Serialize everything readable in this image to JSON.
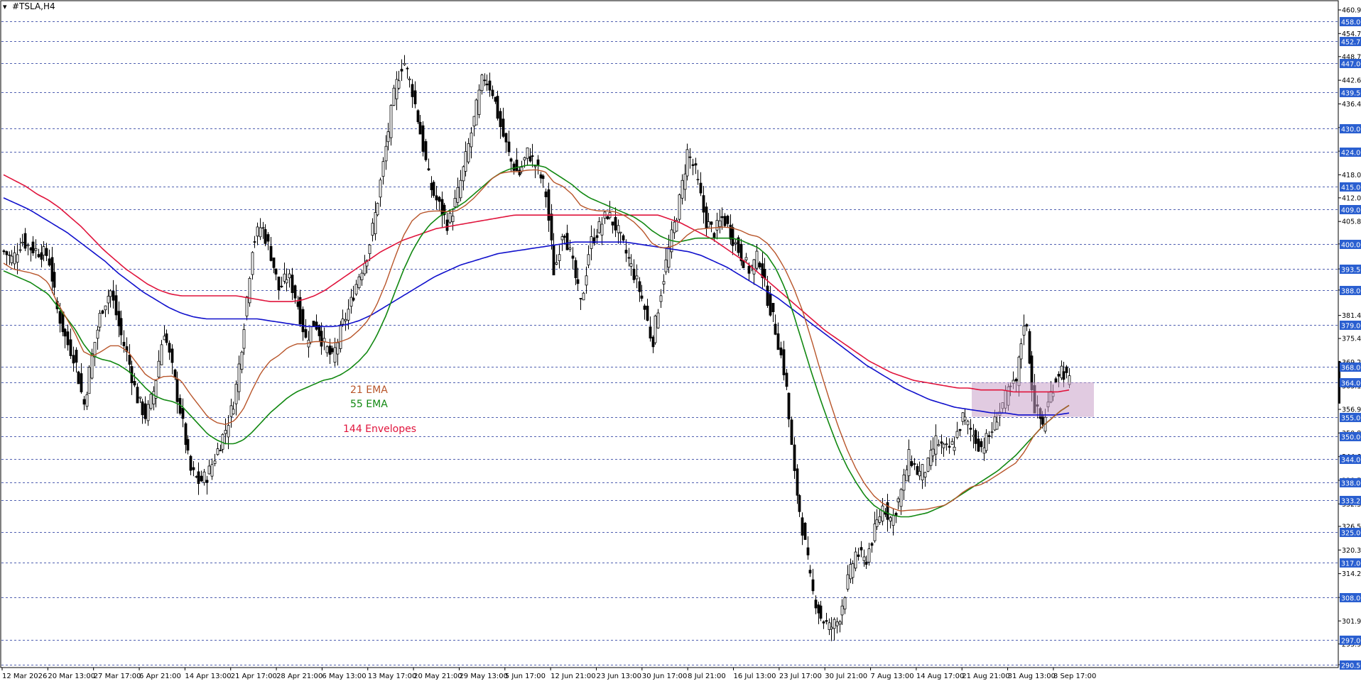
{
  "window": {
    "title": "#TSLA,H4"
  },
  "indicators": {
    "ema21_label": "21 EMA",
    "ema55_label": "55 EMA",
    "env144_label": "144 Envelopes"
  },
  "colors": {
    "background": "#ffffff",
    "candle": "#000000",
    "ema21": "#b8552a",
    "ema55": "#118811",
    "envelope_upper": "#e0143c",
    "envelope_lower": "#1010cc",
    "grid": "#5060b0",
    "price_tag_bg": "#2a5fd0",
    "zone_fill": "#c8a0c8",
    "current_price_bar": "#000000"
  },
  "chart_data": {
    "type": "candlestick",
    "symbol": "#TSLA",
    "timeframe": "H4",
    "ylim": [
      290.5,
      460.9
    ],
    "price_axis_ticks": [
      "460.90",
      "454.75",
      "448.75",
      "442.60",
      "436.45",
      "430.30",
      "424.15",
      "418.00",
      "412.00",
      "405.85",
      "400.00",
      "393.50",
      "388.00",
      "381.40",
      "375.40",
      "369.25",
      "363.10",
      "356.95",
      "350.80",
      "344.65",
      "338.50",
      "332.35",
      "326.50",
      "320.35",
      "314.20",
      "308.00",
      "301.90",
      "295.90",
      "290.50"
    ],
    "highlighted_levels": [
      "458.00",
      "452.75",
      "447.00",
      "439.50",
      "430.00",
      "424.00",
      "415.00",
      "409.00",
      "400.00",
      "393.50",
      "388.00",
      "379.00",
      "368.00",
      "364.00",
      "355.00",
      "350.00",
      "344.00",
      "338.00",
      "333.25",
      "325.00",
      "317.00",
      "308.00",
      "297.00",
      "290.50"
    ],
    "time_axis_labels": [
      "12 Mar 2026",
      "20 Mar 13:00",
      "27 Mar 17:00",
      "6 Apr 21:00",
      "14 Apr 13:00",
      "21 Apr 17:00",
      "28 Apr 21:00",
      "6 May 13:00",
      "13 May 17:00",
      "20 May 21:00",
      "29 May 13:00",
      "5 Jun 17:00",
      "12 Jun 21:00",
      "23 Jun 13:00",
      "30 Jun 17:00",
      "8 Jul 21:00",
      "16 Jul 13:00",
      "23 Jul 17:00",
      "30 Jul 21:00",
      "7 Aug 13:00",
      "14 Aug 17:00",
      "21 Aug 21:00",
      "31 Aug 13:00",
      "8 Sep 17:00"
    ],
    "close_path": [
      398,
      396,
      401,
      399,
      398,
      397,
      383,
      375,
      370,
      358,
      372,
      383,
      388,
      378,
      370,
      360,
      355,
      363,
      378,
      367,
      355,
      341,
      338,
      340,
      346,
      352,
      360,
      378,
      400,
      405,
      398,
      388,
      392,
      385,
      375,
      380,
      374,
      370,
      378,
      384,
      392,
      398,
      410,
      425,
      440,
      448,
      440,
      428,
      415,
      410,
      405,
      412,
      422,
      433,
      444,
      440,
      430,
      422,
      418,
      424,
      420,
      414,
      392,
      405,
      395,
      384,
      400,
      404,
      408,
      404,
      398,
      392,
      385,
      374,
      388,
      400,
      410,
      424,
      418,
      406,
      403,
      407,
      402,
      397,
      393,
      397,
      386,
      377,
      365,
      340,
      325,
      310,
      303,
      300,
      302,
      312,
      320,
      317,
      325,
      332,
      328,
      335,
      345,
      340,
      342,
      349,
      346,
      348,
      355,
      351,
      347,
      350,
      356,
      361,
      364,
      382,
      358,
      353,
      362,
      368,
      364
    ],
    "ema21": [
      395,
      393.5,
      393,
      392.5,
      391.8,
      390,
      385,
      381,
      377,
      372,
      370.8,
      372,
      373.5,
      373.5,
      372,
      369,
      366,
      364.5,
      365.5,
      365.6,
      364.4,
      361,
      358,
      355,
      353.5,
      353,
      354,
      357,
      362,
      366.5,
      369.5,
      371,
      373,
      374,
      374,
      374.6,
      374.6,
      374.2,
      374.6,
      375.5,
      377.5,
      380,
      384,
      389.5,
      396,
      402,
      406,
      408,
      408.5,
      408.6,
      408.4,
      408.6,
      410,
      412,
      414.5,
      417,
      418.4,
      418.8,
      418.8,
      419.2,
      419.3,
      418.8,
      416,
      415,
      413,
      410,
      409,
      408.6,
      408.6,
      408.3,
      407.3,
      405.7,
      403.4,
      400.2,
      399,
      399.1,
      400.1,
      402.3,
      403.8,
      404,
      404.2,
      404.4,
      404.2,
      403.5,
      402.4,
      401.9,
      400.2,
      397.4,
      393.5,
      388.5,
      382.5,
      375,
      367,
      359.5,
      352.5,
      346.5,
      341.5,
      337.5,
      334.5,
      332.5,
      331.3,
      330.5,
      330.7,
      330.8,
      331,
      331.5,
      332,
      333.4,
      335.3,
      336.8,
      337.3,
      338.5,
      340,
      341.5,
      343,
      346,
      350,
      352.5,
      354.5,
      356.5,
      358
    ],
    "ema55": [
      393,
      392,
      391,
      390,
      388.5,
      387,
      384,
      381,
      378,
      374,
      371,
      370,
      369.5,
      368.5,
      367,
      365,
      362.5,
      360.5,
      359.5,
      359,
      358,
      355.5,
      353,
      350.5,
      349,
      348,
      348,
      349,
      351,
      353.5,
      356,
      358,
      360,
      361.5,
      362.5,
      363.5,
      364.5,
      365,
      366,
      367.5,
      369.5,
      372,
      376,
      381,
      387,
      393,
      398,
      402,
      405,
      407,
      408.5,
      409.5,
      411,
      413,
      415,
      417,
      418.5,
      419.5,
      420,
      420.5,
      420.5,
      420,
      418.5,
      417,
      415.5,
      413.5,
      412,
      411,
      410,
      409,
      408,
      407,
      405.5,
      403.5,
      402,
      401,
      400.5,
      401,
      401.5,
      401.5,
      401.5,
      401.5,
      401.5,
      401,
      400,
      399,
      397,
      393.5,
      388.5,
      381.5,
      374,
      366.5,
      359.5,
      353,
      347,
      342,
      338,
      334.5,
      332,
      330.5,
      329.5,
      329,
      329,
      329.5,
      330,
      331,
      332,
      333.5,
      335,
      336.5,
      338,
      339.5,
      341,
      343,
      345,
      347.5,
      350,
      352.5,
      354.5,
      356.5,
      358
    ],
    "env144_upper": [
      418,
      416.5,
      415,
      413,
      411.5,
      409.5,
      407,
      404.5,
      401.5,
      398.5,
      396,
      393.5,
      391.5,
      389.5,
      388,
      387,
      386.5,
      386.5,
      386.5,
      386.5,
      386.5,
      386.5,
      386,
      385.5,
      385,
      385,
      385,
      385.5,
      386.5,
      388,
      390,
      392,
      394,
      396,
      398,
      399.5,
      401,
      402,
      403,
      404,
      404.5,
      405,
      405.5,
      406,
      406.5,
      407,
      407.5,
      407.5,
      407.5,
      407.5,
      407.5,
      407.5,
      407.5,
      407.5,
      407.5,
      407.5,
      407.5,
      407.5,
      407.5,
      407.5,
      406.5,
      405.5,
      404,
      402.5,
      401,
      399,
      397,
      395,
      392.5,
      390,
      387.5,
      385,
      382.5,
      380,
      377.5,
      375.5,
      373.5,
      371.5,
      369.5,
      368,
      366.5,
      365.5,
      364.5,
      364,
      363.5,
      363,
      362.5,
      362.5,
      362,
      362,
      362,
      361.5,
      361.5,
      361.5,
      361.5,
      361.5,
      362
    ],
    "env144_lower": [
      412,
      410.5,
      409,
      407,
      405,
      403,
      400.5,
      398,
      395.5,
      392.5,
      390,
      387.5,
      385.5,
      383.5,
      382,
      381,
      380.5,
      380.5,
      380.5,
      380.5,
      380.5,
      380,
      379.5,
      379,
      378.5,
      378.5,
      378.5,
      379,
      380,
      381.5,
      383.5,
      385.5,
      387.5,
      389.5,
      391.5,
      393,
      394.5,
      395.5,
      396.5,
      397.5,
      398,
      398.5,
      399,
      399.5,
      400,
      400.5,
      400.5,
      400.5,
      400.5,
      400.5,
      400,
      399.5,
      399,
      398.5,
      398,
      397,
      395.5,
      394,
      392,
      390,
      388,
      386,
      383.5,
      381,
      378.5,
      376,
      373.5,
      371,
      368.5,
      366.5,
      364.5,
      362.5,
      361,
      359.5,
      358.5,
      357.5,
      357,
      356.5,
      356,
      356,
      355.5,
      355.5,
      355.5,
      355.5,
      356
    ],
    "zone": {
      "from_price": 355.0,
      "to_price": 364.0
    },
    "current_price": 364.0,
    "grid": "horizontal-dashed"
  }
}
